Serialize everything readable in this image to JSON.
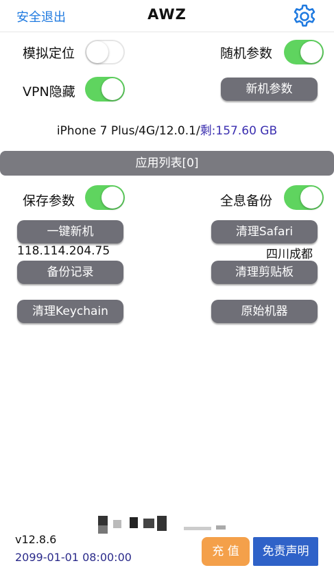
{
  "navbar": {
    "logout_label": "安全退出",
    "title": "AWZ",
    "settings_icon": "gear-icon"
  },
  "controls": {
    "mock_location": {
      "label": "模拟定位",
      "enabled": false
    },
    "random_params": {
      "label": "随机参数",
      "enabled": true
    },
    "vpn_hide": {
      "label": "VPN隐藏",
      "enabled": true
    },
    "new_device_params_label": "新机参数"
  },
  "device": {
    "info": "iPhone 7 Plus/4G/12.0.1/",
    "remaining_label": "剩:",
    "remaining_value": "157.60 GB"
  },
  "app_list_label": "应用列表[0]",
  "options": {
    "save_params": {
      "label": "保存参数",
      "enabled": true
    },
    "full_backup": {
      "label": "全息备份",
      "enabled": true
    }
  },
  "actions": {
    "one_click_new": "一键新机",
    "clear_safari": "清理Safari",
    "backup_records": "备份记录",
    "clear_clipboard": "清理剪贴板",
    "clear_keychain": "清理Keychain",
    "original_device": "原始机器"
  },
  "network": {
    "ip": "118.114.204.75",
    "location": "四川成都"
  },
  "footer": {
    "version": "v12.8.6",
    "expiry": "2099-01-01 08:00:00",
    "charge_label": "充 值",
    "disclaimer_label": "免责声明"
  },
  "colors": {
    "toggle_on": "#5fd45f",
    "button_gray": "#6f6f77",
    "link_blue": "#1f7ae0",
    "charge_orange": "#f4a04a",
    "disclaimer_blue": "#2f62c8"
  }
}
